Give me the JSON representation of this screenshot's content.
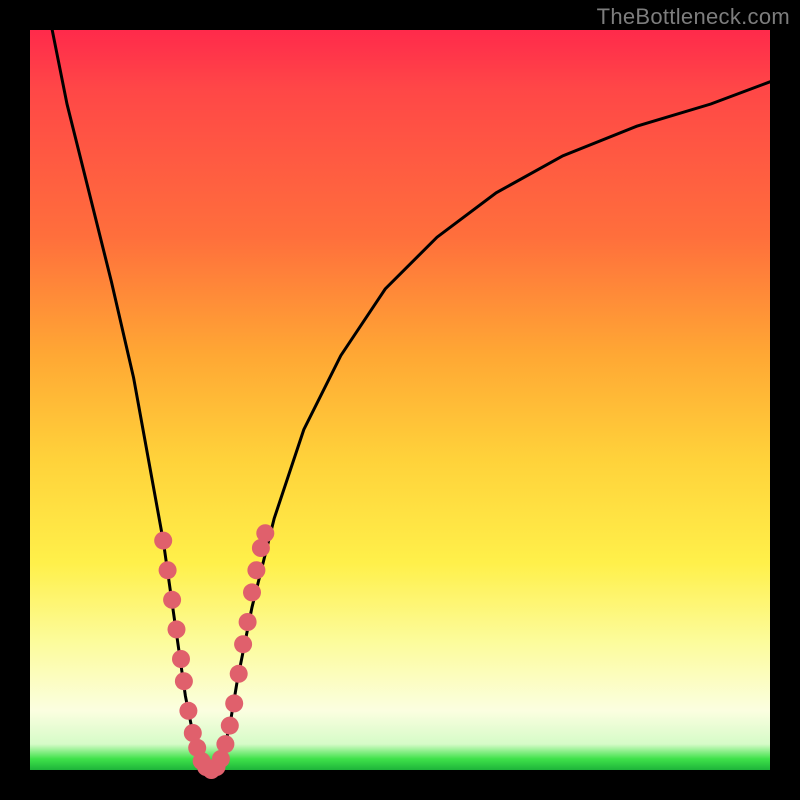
{
  "watermark": "TheBottleneck.com",
  "chart_data": {
    "type": "line",
    "title": "",
    "xlabel": "",
    "ylabel": "",
    "xlim": [
      0,
      100
    ],
    "ylim": [
      0,
      100
    ],
    "series": [
      {
        "name": "bottleneck-curve",
        "color": "#000000",
        "x": [
          3,
          5,
          8,
          11,
          14,
          16,
          18,
          19,
          20,
          21,
          22,
          23,
          24,
          25,
          26,
          27,
          28,
          30,
          33,
          37,
          42,
          48,
          55,
          63,
          72,
          82,
          92,
          100
        ],
        "values": [
          100,
          90,
          78,
          66,
          53,
          42,
          31,
          24,
          17,
          10,
          5,
          2,
          0,
          0,
          2,
          6,
          12,
          22,
          34,
          46,
          56,
          65,
          72,
          78,
          83,
          87,
          90,
          93
        ]
      }
    ],
    "markers": {
      "name": "highlight-dots",
      "color": "#e0606c",
      "points": [
        {
          "x": 18.0,
          "y": 31
        },
        {
          "x": 18.6,
          "y": 27
        },
        {
          "x": 19.2,
          "y": 23
        },
        {
          "x": 19.8,
          "y": 19
        },
        {
          "x": 20.4,
          "y": 15
        },
        {
          "x": 20.8,
          "y": 12
        },
        {
          "x": 21.4,
          "y": 8
        },
        {
          "x": 22.0,
          "y": 5
        },
        {
          "x": 22.6,
          "y": 3
        },
        {
          "x": 23.2,
          "y": 1.2
        },
        {
          "x": 23.8,
          "y": 0.4
        },
        {
          "x": 24.5,
          "y": 0
        },
        {
          "x": 25.2,
          "y": 0.4
        },
        {
          "x": 25.8,
          "y": 1.5
        },
        {
          "x": 26.4,
          "y": 3.5
        },
        {
          "x": 27.0,
          "y": 6
        },
        {
          "x": 27.6,
          "y": 9
        },
        {
          "x": 28.2,
          "y": 13
        },
        {
          "x": 28.8,
          "y": 17
        },
        {
          "x": 29.4,
          "y": 20
        },
        {
          "x": 30.0,
          "y": 24
        },
        {
          "x": 30.6,
          "y": 27
        },
        {
          "x": 31.2,
          "y": 30
        },
        {
          "x": 31.8,
          "y": 32
        }
      ]
    }
  }
}
